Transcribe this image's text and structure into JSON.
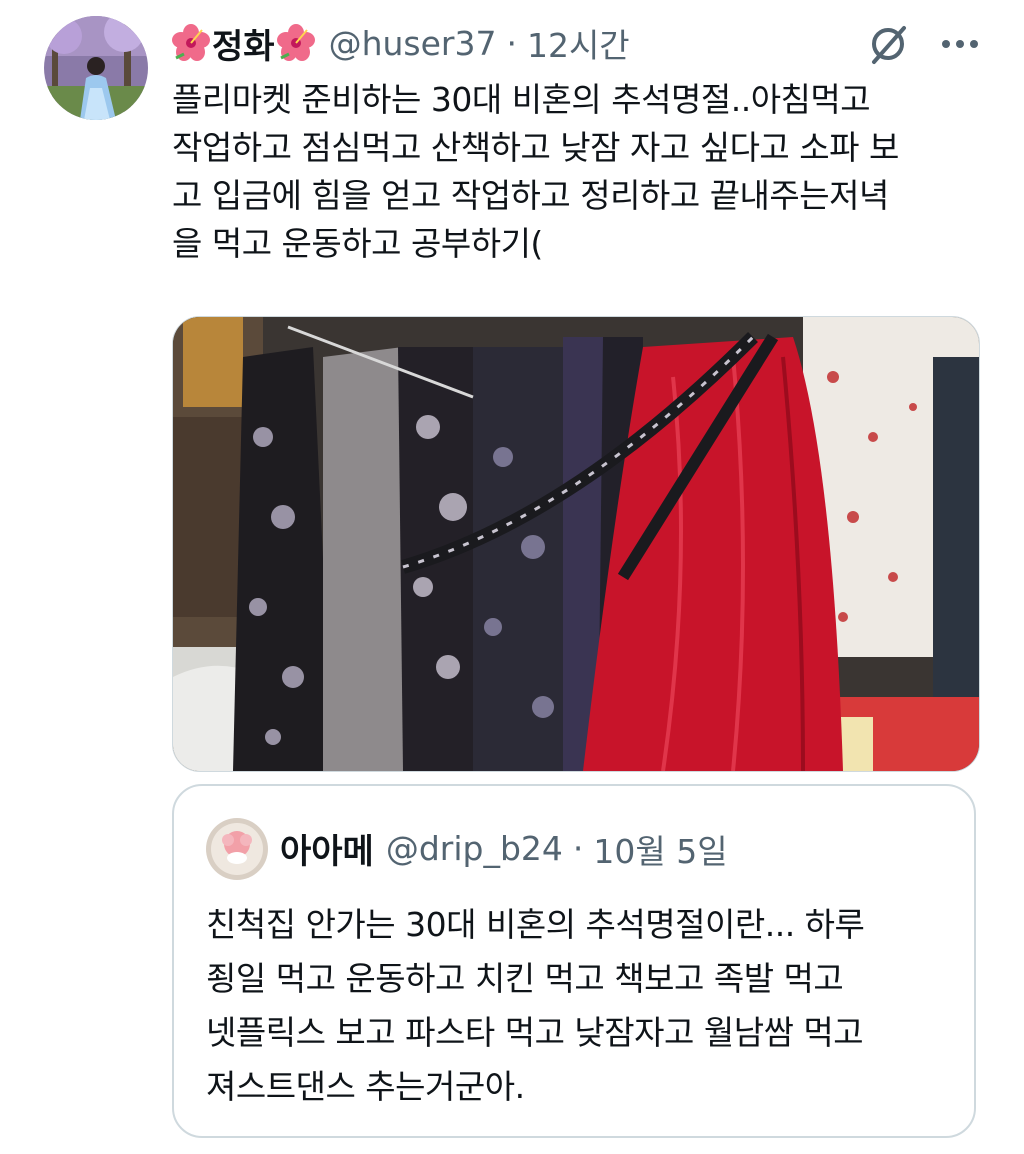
{
  "tweet": {
    "display_name": "정화",
    "handle": "@huser37",
    "separator": "·",
    "time": "12시간",
    "text": "플리마켓 준비하는 30대 비혼의 추석명절..아침먹고\n작업하고 점심먹고 산책하고 낮잠 자고 싶다고 소파 보\n고 입금에 힘을 얻고 작업하고 정리하고 끝내주는저녁\n을 먹고 운동하고 공부하기(",
    "name_emoji_icon": "hibiscus-icon",
    "action_icons": [
      "grok-icon",
      "more-icon"
    ]
  },
  "quote": {
    "display_name": "아아메",
    "handle": "@drip_b24",
    "separator": "·",
    "time": "10월 5일",
    "text": "친척집 안가는 30대 비혼의 추석명절이란... 하루\n죙일 먹고 운동하고 치킨 먹고 책보고 족발 먹고\n넷플릭스 보고 파스타 먹고 낮잠자고 월남쌈 먹고\n져스트댄스 추는거군아."
  },
  "colors": {
    "text_primary": "#0f1419",
    "text_secondary": "#536471",
    "border": "#cfd9de"
  }
}
